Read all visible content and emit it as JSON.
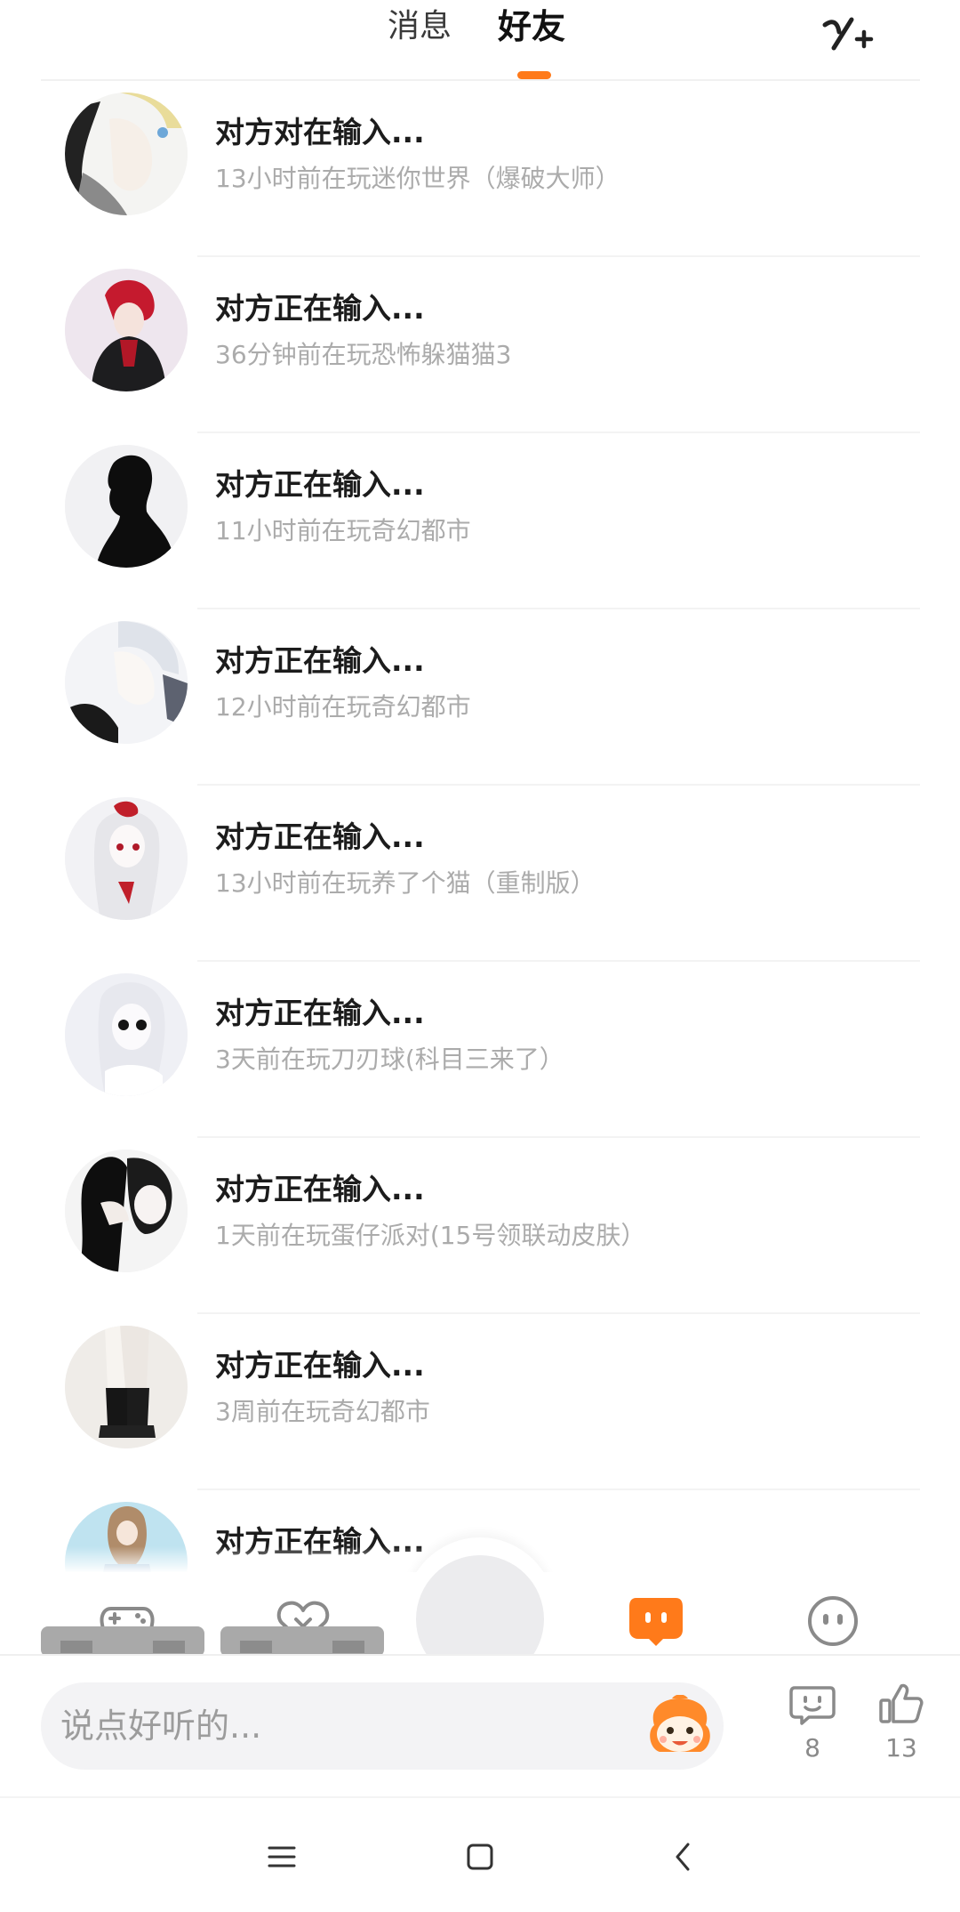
{
  "tabs": {
    "messages": "消息",
    "friends": "好友"
  },
  "friends": [
    {
      "name": "对方对在输入...",
      "status": "13小时前在玩迷你世界（爆破大师）"
    },
    {
      "name": "对方正在输入...",
      "status": "36分钟前在玩恐怖躲猫猫3"
    },
    {
      "name": "对方正在输入...",
      "status": "11小时前在玩奇幻都市"
    },
    {
      "name": "对方正在输入...",
      "status": "12小时前在玩奇幻都市"
    },
    {
      "name": "对方正在输入...",
      "status": "13小时前在玩养了个猫（重制版）"
    },
    {
      "name": "对方正在输入...",
      "status": "3天前在玩刀刃球(科目三来了）"
    },
    {
      "name": "对方正在输入...",
      "status": "1天前在玩蛋仔派对(15号领联动皮肤）"
    },
    {
      "name": "对方正在输入...",
      "status": "3周前在玩奇幻都市"
    },
    {
      "name": "对方正在输入...",
      "status": ""
    }
  ],
  "comment_bar": {
    "placeholder": "说点好听的...",
    "comment_count": "8",
    "like_count": "13"
  },
  "colors": {
    "accent": "#ff7a1a",
    "icon_gray": "#8a8a8a",
    "status_text": "#ababab"
  },
  "icons": [
    "add-friend-icon",
    "gamepad-icon",
    "heart-icon",
    "chat-bubble-icon",
    "smiley-icon",
    "mascot-icon",
    "comment-icon",
    "thumbs-up-icon",
    "menu-icon",
    "home-icon",
    "back-icon"
  ]
}
